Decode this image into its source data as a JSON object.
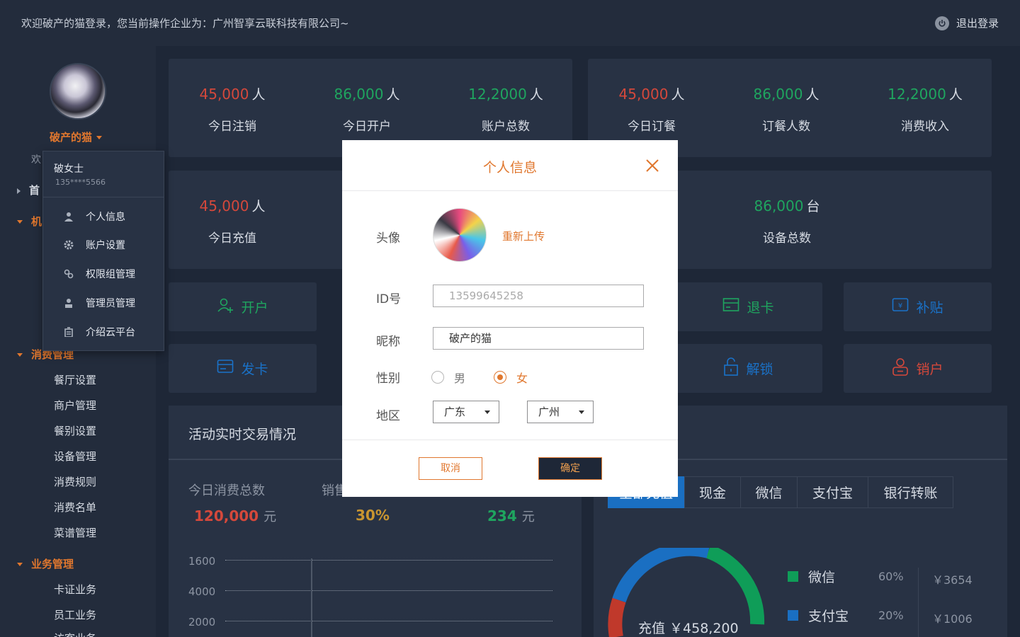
{
  "header": {
    "welcome": "欢迎破产的猫登录，您当前操作企业为：广州智享云联科技有限公司~",
    "logout_label": "退出登录"
  },
  "sidebar": {
    "username": "破产的猫",
    "hint_prefix": "欢",
    "top_items": [
      {
        "label": "首"
      },
      {
        "label": "机"
      }
    ],
    "sections": [
      {
        "label": "消费管理",
        "items": [
          "餐厅设置",
          "商户管理",
          "餐别设置",
          "设备管理",
          "消费规则",
          "消费名单",
          "菜谱管理"
        ]
      },
      {
        "label": "业务管理",
        "items": [
          "卡证业务",
          "员工业务",
          "访客业务"
        ]
      }
    ]
  },
  "user_menu": {
    "name": "破女士",
    "phone": "135****5566",
    "items": [
      {
        "label": "个人信息",
        "icon": "user-icon"
      },
      {
        "label": "账户设置",
        "icon": "gear-icon"
      },
      {
        "label": "权限组管理",
        "icon": "link-icon"
      },
      {
        "label": "管理员管理",
        "icon": "admin-icon"
      },
      {
        "label": "介绍云平台",
        "icon": "building-icon"
      }
    ]
  },
  "stats_row1": [
    {
      "value": "45,000",
      "unit": "人",
      "label": "今日注销",
      "color": "#d4483b"
    },
    {
      "value": "86,000",
      "unit": "人",
      "label": "今日开户",
      "color": "#1fa55f"
    },
    {
      "value": "12,2000",
      "unit": "人",
      "label": "账户总数",
      "color": "#1fa55f"
    },
    {
      "value": "45,000",
      "unit": "人",
      "label": "今日订餐",
      "color": "#d4483b"
    },
    {
      "value": "86,000",
      "unit": "人",
      "label": "订餐人数",
      "color": "#1fa55f"
    },
    {
      "value": "12,2000",
      "unit": "人",
      "label": "消费收入",
      "color": "#1fa55f"
    }
  ],
  "stats_row2": [
    {
      "value": "45,000",
      "unit": "人",
      "label": "今日充值",
      "color": "#d4483b"
    },
    {
      "value": "86,000",
      "unit": "台",
      "label": "设备总数",
      "color": "#1fa55f"
    }
  ],
  "actions": [
    {
      "label": "开户",
      "icon": "add-user-icon",
      "color": "#1fa55f"
    },
    {
      "label": "退卡",
      "icon": "card-icon",
      "color": "#1fa55f"
    },
    {
      "label": "补贴",
      "icon": "subsidy-icon",
      "color": "#1a72c9"
    },
    {
      "label": "发卡",
      "icon": "card-icon",
      "color": "#1a72c9"
    },
    {
      "label": "解锁",
      "icon": "unlock-icon",
      "color": "#1a72c9"
    },
    {
      "label": "销户",
      "icon": "delete-user-icon",
      "color": "#d4483b"
    }
  ],
  "realtime": {
    "title": "活动实时交易情况",
    "metrics": [
      {
        "label": "今日消费总数",
        "value": "120,000",
        "unit": "元",
        "color": "#d4483b"
      },
      {
        "label": "销售",
        "value": "30%",
        "unit": "",
        "color": "#c99530"
      },
      {
        "label": "",
        "value": "234",
        "unit": "元",
        "color": "#1fa55f"
      }
    ],
    "y_ticks": [
      "1600",
      "4000",
      "2000"
    ]
  },
  "payments": {
    "tabs": [
      "全部充值",
      "现金",
      "微信",
      "支付宝",
      "银行转账"
    ],
    "center_label": "充值 ￥458,200",
    "legend": [
      {
        "name": "微信",
        "percent": "60%",
        "amount": "￥3654",
        "color": "#0f9d58"
      },
      {
        "name": "支付宝",
        "percent": "20%",
        "amount": "￥1006",
        "color": "#1a6fc2"
      }
    ]
  },
  "modal": {
    "title": "个人信息",
    "avatar_label": "头像",
    "reupload": "重新上传",
    "id_label": "ID号",
    "id_placeholder": "13599645258",
    "nick_label": "昵称",
    "nick_value": "破产的猫",
    "gender_label": "性别",
    "gender_male": "男",
    "gender_female": "女",
    "gender_selected": "女",
    "region_label": "地区",
    "province": "广东",
    "city": "广州",
    "cancel": "取消",
    "confirm": "确定"
  }
}
